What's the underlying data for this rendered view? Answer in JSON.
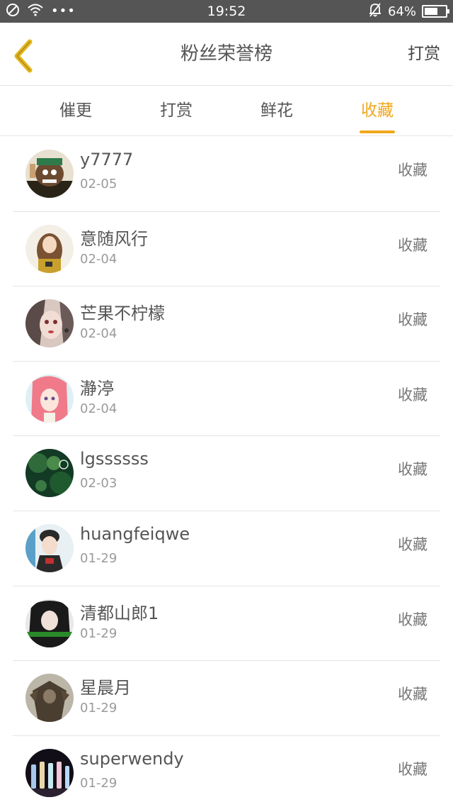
{
  "status_bar": {
    "time": "19:52",
    "battery": "64%",
    "battery_level": 0.64,
    "icons_left": [
      "do-not-disturb-icon",
      "wifi-icon",
      "more-dots-icon"
    ],
    "icons_right": [
      "bell-off-icon",
      "battery-icon"
    ]
  },
  "nav": {
    "title": "粉丝荣誉榜",
    "action": "打赏",
    "back_icon": "chevron-left-icon",
    "back_color": "#e6b820"
  },
  "tabs": [
    {
      "label": "催更"
    },
    {
      "label": "打赏"
    },
    {
      "label": "鲜花"
    },
    {
      "label": "收藏"
    }
  ],
  "active_tab": 3,
  "accent_color": "#f0a81c",
  "entries": [
    {
      "name": "y7777",
      "date": "02-05",
      "action": "收藏"
    },
    {
      "name": "意随风行",
      "date": "02-04",
      "action": "收藏"
    },
    {
      "name": "芒果不柠檬",
      "date": "02-04",
      "action": "收藏"
    },
    {
      "name": "瀞渟",
      "date": "02-04",
      "action": "收藏"
    },
    {
      "name": "lgssssss",
      "date": "02-03",
      "action": "收藏"
    },
    {
      "name": "huangfeiqwe",
      "date": "01-29",
      "action": "收藏"
    },
    {
      "name": "清都山郎1",
      "date": "01-29",
      "action": "收藏"
    },
    {
      "name": "星晨月",
      "date": "01-29",
      "action": "收藏"
    },
    {
      "name": "superwendy",
      "date": "01-29",
      "action": "收藏"
    }
  ]
}
